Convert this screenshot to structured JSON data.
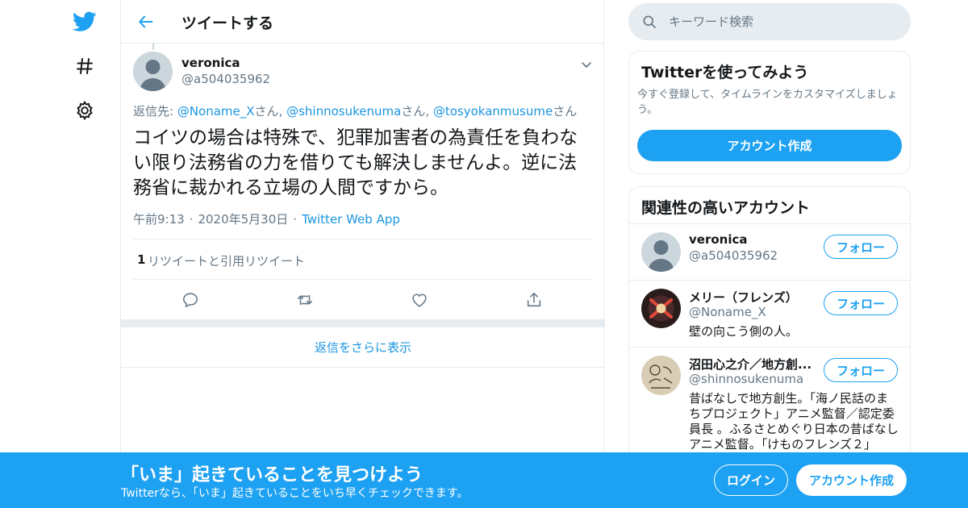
{
  "colors": {
    "brand": "#1da1f2",
    "link": "#1b95e0",
    "muted": "#657786",
    "border": "#e6ecf0"
  },
  "nav": {
    "icons": [
      "twitter-bird-icon",
      "hashtag-icon",
      "gear-icon"
    ]
  },
  "header": {
    "title": "ツイートする"
  },
  "tweet": {
    "author_name": "veronica",
    "author_handle": "@a504035962",
    "reply_prefix": "返信先: ",
    "mentions": [
      "@Noname_X",
      "@shinnosukenuma",
      "@tosyokanmusume"
    ],
    "mention_suffix": "さん",
    "mention_separator": ", ",
    "text": "コイツの場合は特殊で、犯罪加害者の為責任を負わない限り法務省の力を借りても解決しませんよ。逆に法務省に裁かれる立場の人間ですから。",
    "time": "午前9:13",
    "date": "2020年5月30日",
    "source": "Twitter Web App",
    "retweet_count": "1",
    "retweet_label": "リツイートと引用リツイート"
  },
  "show_more_replies": "返信をさらに表示",
  "search": {
    "placeholder": "キーワード検索"
  },
  "signup_card": {
    "title": "Twitterを使ってみよう",
    "description": "今すぐ登録して、タイムラインをカスタマイズしましょう。",
    "button": "アカウント作成"
  },
  "related": {
    "title": "関連性の高いアカウント",
    "follow_label": "フォロー",
    "accounts": [
      {
        "name": "veronica",
        "handle": "@a504035962",
        "bio": ""
      },
      {
        "name": "メリー（フレンズ）",
        "handle": "@Noname_X",
        "bio": "壁の向こう側の人。"
      },
      {
        "name": "沼田心之介／地方創...",
        "handle": "@shinnosukenuma",
        "bio": "昔ばなしで地方創生。「海ノ民話のまちプロジェクト」アニメ監督／認定委員長 。ふるさとめぐり日本の昔ばなしアニメ監督。「けものフレンズ２」"
      }
    ]
  },
  "bottom_bar": {
    "title": "「いま」起きていることを見つけよう",
    "subtitle": "Twitterなら、「いま」起きていることをいち早くチェックできます。",
    "login": "ログイン",
    "signup": "アカウント作成"
  }
}
